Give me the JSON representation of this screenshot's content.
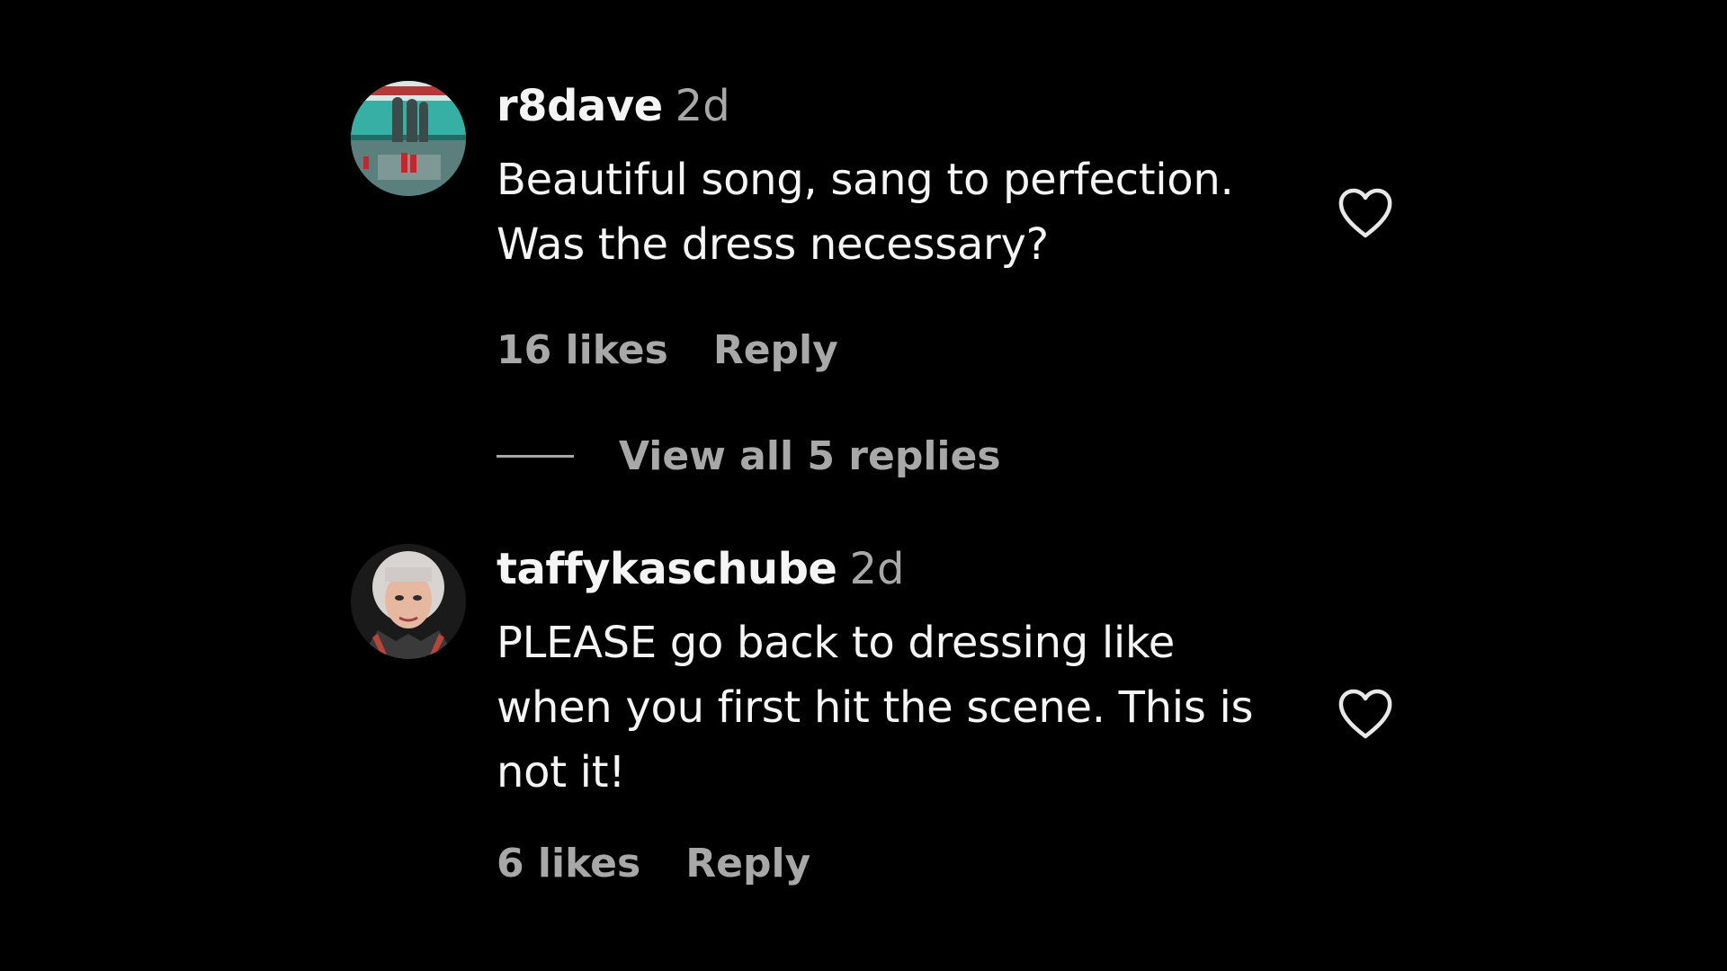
{
  "comments": [
    {
      "username": "r8dave",
      "time": "2d",
      "text_lines": [
        "Beautiful song, sang to perfection.",
        "Was the dress necessary?"
      ],
      "likes": "16 likes",
      "reply_label": "Reply",
      "avatar_icon": "stadium-statue-photo-avatar",
      "like_icon": "heart-outline-icon"
    },
    {
      "username": "taffykaschube",
      "time": "2d",
      "text_lines": [
        "PLEASE go back to dressing like",
        "when you first hit the scene. This is",
        "not it!"
      ],
      "likes": "6 likes",
      "reply_label": "Reply",
      "avatar_icon": "woman-portrait-photo-avatar",
      "like_icon": "heart-outline-icon"
    }
  ],
  "view_replies": {
    "label": "View all 5 replies"
  },
  "colors": {
    "background": "#000000",
    "primary_text": "#f5f5f5",
    "secondary_text": "#a8a8a8"
  }
}
